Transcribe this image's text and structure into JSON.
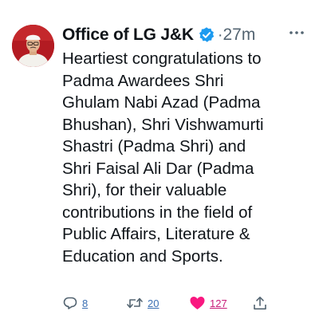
{
  "tweet": {
    "author_name": "Office of LG J&K",
    "separator": "·",
    "time_ago": "27m",
    "text_lines": [
      "Heartiest congratulations to",
      "Padma Awardees Shri",
      "Ghulam Nabi Azad (Padma",
      "Bhushan), Shri Vishwamurti",
      "Shastri  (Padma Shri) and",
      "Shri Faisal Ali Dar (Padma",
      "Shri), for their valuable",
      "contributions in the field of",
      "Public Affairs, Literature &",
      "Education and Sports."
    ],
    "icons": {
      "avatar": "profile-photo",
      "verified": "verified-badge-icon",
      "more": "more-options-icon",
      "reply": "reply-icon",
      "retweet": "retweet-icon",
      "like": "like-heart-icon",
      "share": "share-icon"
    },
    "colors": {
      "verified_blue": "#1d9bf0",
      "like_pink": "#f91880",
      "secondary_gray": "#536471"
    }
  },
  "actions": {
    "reply_count": "8",
    "retweet_count": "20",
    "like_count": "127"
  }
}
